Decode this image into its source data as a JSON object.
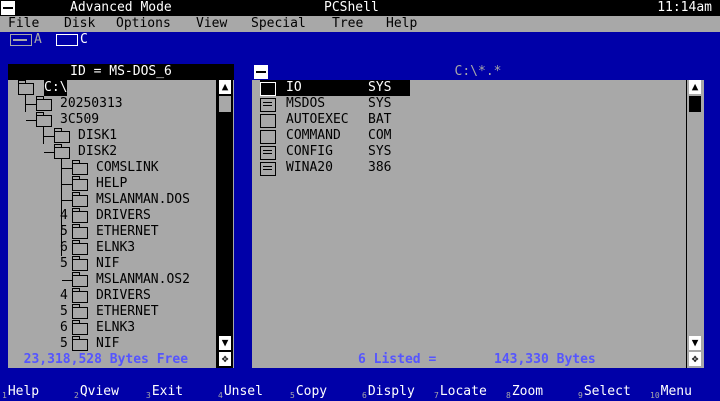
{
  "titlebar": {
    "mode": "Advanced Mode",
    "app": "PCShell",
    "clock": "11:14am"
  },
  "menu": [
    "File",
    "Disk",
    "Options",
    "View",
    "Special",
    "Tree",
    "Help"
  ],
  "drives": [
    "A",
    "C"
  ],
  "tree_panel": {
    "header": "ID = MS-DOS_6",
    "root": "C:\\",
    "nodes": [
      {
        "name": "20250313",
        "depth": 1,
        "mark": ""
      },
      {
        "name": "3C509",
        "depth": 1,
        "mark": ""
      },
      {
        "name": "DISK1",
        "depth": 2,
        "mark": ""
      },
      {
        "name": "DISK2",
        "depth": 2,
        "mark": ""
      },
      {
        "name": "COMSLINK",
        "depth": 3,
        "mark": ""
      },
      {
        "name": "HELP",
        "depth": 3,
        "mark": ""
      },
      {
        "name": "MSLANMAN.DOS",
        "depth": 3,
        "mark": ""
      },
      {
        "name": "DRIVERS",
        "depth": 3,
        "mark": "4"
      },
      {
        "name": "ETHERNET",
        "depth": 3,
        "mark": "5"
      },
      {
        "name": "ELNK3",
        "depth": 3,
        "mark": "6"
      },
      {
        "name": "NIF",
        "depth": 3,
        "mark": "5"
      },
      {
        "name": "MSLANMAN.OS2",
        "depth": 3,
        "mark": ""
      },
      {
        "name": "DRIVERS",
        "depth": 3,
        "mark": "4"
      },
      {
        "name": "ETHERNET",
        "depth": 3,
        "mark": "5"
      },
      {
        "name": "ELNK3",
        "depth": 3,
        "mark": "6"
      },
      {
        "name": "NIF",
        "depth": 3,
        "mark": "5"
      }
    ],
    "footer": "23,318,528 Bytes Free"
  },
  "file_panel": {
    "header": "C:\\*.*",
    "files": [
      {
        "name": "IO",
        "ext": "SYS",
        "icon": "doc"
      },
      {
        "name": "MSDOS",
        "ext": "SYS",
        "icon": "doc"
      },
      {
        "name": "AUTOEXEC",
        "ext": "BAT",
        "icon": "blank"
      },
      {
        "name": "COMMAND",
        "ext": "COM",
        "icon": "blank"
      },
      {
        "name": "CONFIG",
        "ext": "SYS",
        "icon": "doc"
      },
      {
        "name": "WINA20",
        "ext": "386",
        "icon": "doc"
      }
    ],
    "footer_count": "6 Listed =",
    "footer_bytes": "143,330 Bytes"
  },
  "fkeys": [
    {
      "n": "1",
      "label": "Help"
    },
    {
      "n": "2",
      "label": "Qview"
    },
    {
      "n": "3",
      "label": "Exit"
    },
    {
      "n": "4",
      "label": "Unsel"
    },
    {
      "n": "5",
      "label": "Copy"
    },
    {
      "n": "6",
      "label": "Disply"
    },
    {
      "n": "7",
      "label": "Locate"
    },
    {
      "n": "8",
      "label": "Zoom"
    },
    {
      "n": "9",
      "label": "Select"
    },
    {
      "n": "10",
      "label": "Menu"
    }
  ],
  "icons": {
    "system_menu": "minus-box-icon",
    "drive": "drive-icon",
    "folder": "folder-icon",
    "file": "file-icon",
    "scroll_up": "arrow-up-icon",
    "scroll_down": "arrow-down-icon",
    "resize": "move-icon"
  }
}
